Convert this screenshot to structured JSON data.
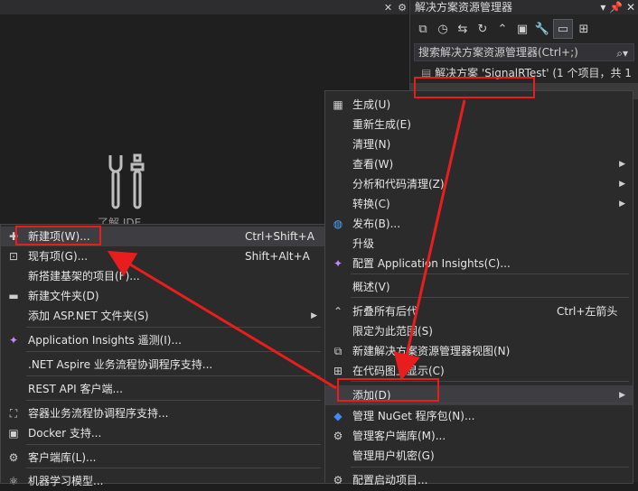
{
  "solution_explorer": {
    "title": "解决方案资源管理器",
    "search_placeholder": "搜索解决方案资源管理器(Ctrl+;)",
    "solution_row": "解决方案 'SignalRTest' (1 个项目，共 1"
  },
  "editor": {
    "ide_label": "了解 IDE"
  },
  "context_menu": {
    "items": [
      {
        "label": "生成(U)",
        "icon": "build-icon"
      },
      {
        "label": "重新生成(E)"
      },
      {
        "label": "清理(N)"
      },
      {
        "label": "查看(W)",
        "submenu": true
      },
      {
        "label": "分析和代码清理(Z)",
        "submenu": true
      },
      {
        "label": "转换(C)",
        "submenu": true
      },
      {
        "label": "发布(B)...",
        "icon": "globe-icon"
      },
      {
        "label": "升级"
      },
      {
        "label": "配置 Application Insights(C)...",
        "icon": "insights-icon"
      },
      {
        "label": "概述(V)"
      },
      {
        "label": "折叠所有后代",
        "shortcut": "Ctrl+左箭头",
        "icon": "collapse-icon"
      },
      {
        "label": "限定为此范围(S)"
      },
      {
        "label": "新建解决方案资源管理器视图(N)",
        "icon": "new-view-icon"
      },
      {
        "label": "在代码图上显示(C)",
        "icon": "code-map-icon"
      },
      {
        "label": "添加(D)",
        "submenu": true
      },
      {
        "label": "管理 NuGet 程序包(N)...",
        "icon": "nuget-icon"
      },
      {
        "label": "管理客户端库(M)...",
        "icon": "client-lib-icon"
      },
      {
        "label": "管理用户机密(G)"
      },
      {
        "label": "配置启动项目...",
        "icon": "gear-icon"
      }
    ]
  },
  "add_submenu": {
    "items": [
      {
        "label": "新建项(W)...",
        "shortcut": "Ctrl+Shift+A",
        "icon": "new-item-icon"
      },
      {
        "label": "现有项(G)...",
        "shortcut": "Shift+Alt+A",
        "icon": "existing-item-icon"
      },
      {
        "label": "新搭建基架的项目(F)..."
      },
      {
        "label": "新建文件夹(D)",
        "icon": "folder-icon"
      },
      {
        "label": "添加 ASP.NET 文件夹(S)",
        "submenu": true
      },
      {
        "label": "Application Insights 遥测(I)...",
        "icon": "insights-icon"
      },
      {
        "label": ".NET Aspire 业务流程协调程序支持..."
      },
      {
        "label": "REST API 客户端..."
      },
      {
        "label": "容器业务流程协调程序支持...",
        "icon": "container-icon"
      },
      {
        "label": "Docker 支持...",
        "icon": "docker-icon"
      },
      {
        "label": "客户端库(L)...",
        "icon": "client-lib-icon"
      },
      {
        "label": "机器学习模型...",
        "icon": "ml-icon"
      }
    ]
  },
  "colors": {
    "highlight_box": "#e81e1e",
    "menu_bg": "#2b2b2b",
    "hover": "#3e3e42"
  }
}
